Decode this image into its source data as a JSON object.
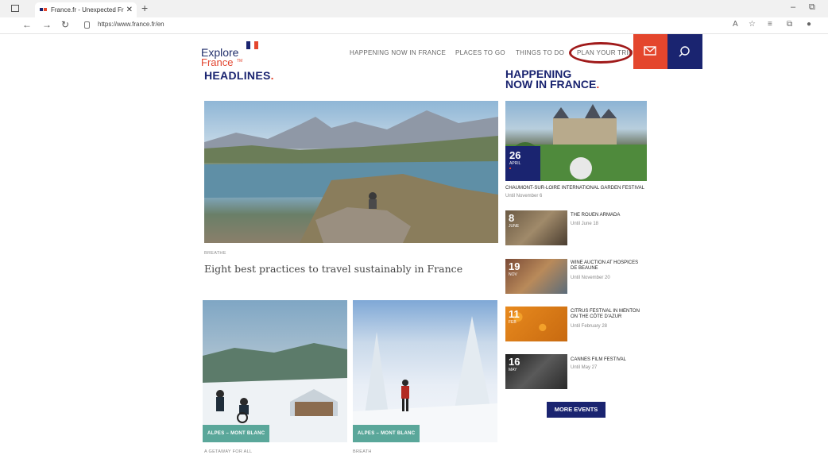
{
  "browser": {
    "tab_title": "France.fr - Unexpected France b",
    "tab_close": "✕",
    "new_tab": "+",
    "url": "https://www.france.fr/en",
    "minimize": "–",
    "restore": "⧉"
  },
  "header": {
    "logo_line1": "Explore",
    "logo_line2": "France",
    "logo_tm": "TM",
    "nav": [
      "HAPPENING NOW IN FRANCE",
      "PLACES TO GO",
      "THINGS TO DO",
      "PLAN YOUR TRIP"
    ],
    "colors": {
      "navy": "#1a2470",
      "red": "#e4462d"
    }
  },
  "headlines": {
    "heading": "HEADLINES",
    "dot": ".",
    "main_caption": "BREATHE",
    "main_title": "Eight best practices to travel sustainably in France",
    "card_a_tag": "ALPES – MONT BLANC",
    "card_a_caption": "A GETAWAY FOR ALL",
    "card_b_tag": "ALPES – MONT BLANC",
    "card_b_caption": "BREATH"
  },
  "happening": {
    "heading_line1": "HAPPENING",
    "heading_line2": "NOW IN FRANCE",
    "dot": ".",
    "featured": {
      "day": "26",
      "month": "APRIL",
      "title": "CHAUMONT-SUR-LOIRE INTERNATIONAL GARDEN FESTIVAL",
      "until": "Until November 6"
    },
    "events": [
      {
        "day": "8",
        "month": "JUNE",
        "title": "THE ROUEN ARMADA",
        "until": "Until June 18"
      },
      {
        "day": "19",
        "month": "NOV",
        "title": "WINE AUCTION AT HOSPICES DE BEAUNE",
        "until": "Until November 20"
      },
      {
        "day": "11",
        "month": "FEB",
        "title": "CITRUS FESTIVAL IN MENTON ON THE CÔTE D'AZUR",
        "until": "Until February 28"
      },
      {
        "day": "16",
        "month": "MAY",
        "title": "CANNES FILM FESTIVAL",
        "until": "Until May 27"
      }
    ],
    "more_button": "MORE EVENTS"
  }
}
